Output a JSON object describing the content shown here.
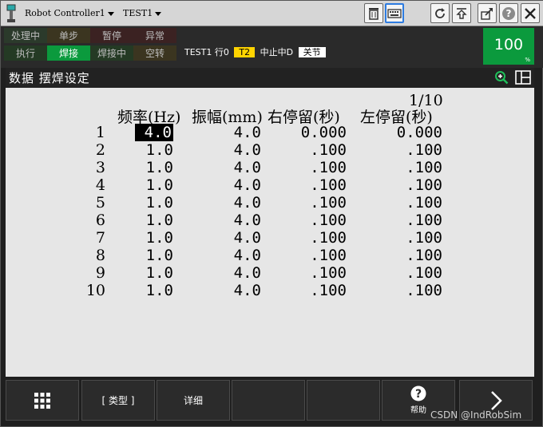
{
  "topbar": {
    "controller": "Robot Controller1",
    "program": "TEST1"
  },
  "status": {
    "cells": [
      {
        "label": "处理中",
        "color": "#2b3a2b",
        "text_color": "#bdbdbd"
      },
      {
        "label": "单步",
        "color": "#3b3520",
        "text_color": "#bdbdbd"
      },
      {
        "label": "暂停",
        "color": "#3b2222",
        "text_color": "#bdbdbd"
      },
      {
        "label": "异常",
        "color": "#3b2222",
        "text_color": "#bdbdbd"
      },
      {
        "label": "执行",
        "color": "#243a24",
        "text_color": "#bdbdbd"
      },
      {
        "label": "焊接",
        "color": "#0b9a3d",
        "text_color": "#ffffff"
      },
      {
        "label": "焊接中",
        "color": "#243a24",
        "text_color": "#bdbdbd"
      },
      {
        "label": "空转",
        "color": "#3b3520",
        "text_color": "#bdbdbd"
      }
    ],
    "program": "TEST1",
    "line": "行0",
    "mode": "T2",
    "state": "中止中D",
    "joint": "关节",
    "override_value": "100",
    "override_unit": "%",
    "accent_green": "#0b9a3d",
    "accent_yellow": "#ffd400"
  },
  "title": {
    "text": "数据 摆焊设定"
  },
  "table": {
    "pager": "1/10",
    "headers": [
      "频率(Hz)",
      "振幅(mm)",
      "右停留(秒)",
      "左停留(秒)"
    ],
    "rows": [
      {
        "index": "1",
        "freq": "4.0",
        "amp": "4.0",
        "right": "0.000",
        "left": "0.000"
      },
      {
        "index": "2",
        "freq": "1.0",
        "amp": "4.0",
        "right": ".100",
        "left": ".100"
      },
      {
        "index": "3",
        "freq": "1.0",
        "amp": "4.0",
        "right": ".100",
        "left": ".100"
      },
      {
        "index": "4",
        "freq": "1.0",
        "amp": "4.0",
        "right": ".100",
        "left": ".100"
      },
      {
        "index": "5",
        "freq": "1.0",
        "amp": "4.0",
        "right": ".100",
        "left": ".100"
      },
      {
        "index": "6",
        "freq": "1.0",
        "amp": "4.0",
        "right": ".100",
        "left": ".100"
      },
      {
        "index": "7",
        "freq": "1.0",
        "amp": "4.0",
        "right": ".100",
        "left": ".100"
      },
      {
        "index": "8",
        "freq": "1.0",
        "amp": "4.0",
        "right": ".100",
        "left": ".100"
      },
      {
        "index": "9",
        "freq": "1.0",
        "amp": "4.0",
        "right": ".100",
        "left": ".100"
      },
      {
        "index": "10",
        "freq": "1.0",
        "amp": "4.0",
        "right": ".100",
        "left": ".100"
      }
    ]
  },
  "softkeys": {
    "menu_icon": "grid-menu-icon",
    "type_label": "[ 类型 ]",
    "detail_label": "详细",
    "help_label": "帮助",
    "help_icon": "help-icon",
    "next_icon": "chevron-right-icon"
  },
  "watermark": "CSDN @IndRobSim"
}
